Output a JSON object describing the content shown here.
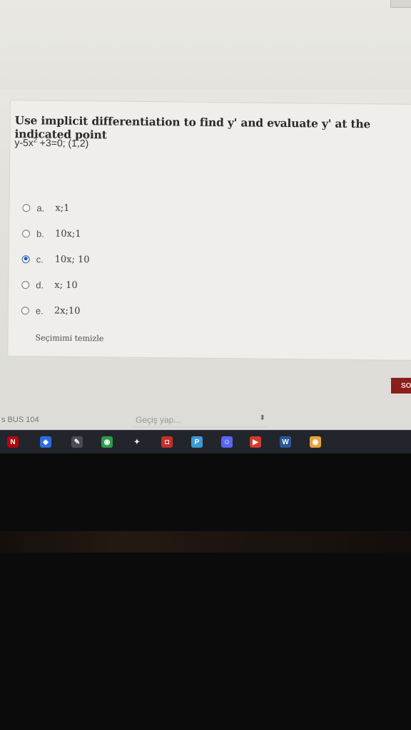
{
  "question": {
    "text": "Use implicit differentiation to find y' and evaluate y' at the indicated point",
    "equation_prefix": "y-5x",
    "equation_exponent": "2",
    "equation_suffix": " +3=0; (1,2)"
  },
  "options": [
    {
      "letter": "a.",
      "value": "x;1",
      "selected": false
    },
    {
      "letter": "b.",
      "value": "10x;1",
      "selected": false
    },
    {
      "letter": "c.",
      "value": "10x; 10",
      "selected": true
    },
    {
      "letter": "d.",
      "value": "x; 10",
      "selected": false
    },
    {
      "letter": "e.",
      "value": "2x;10",
      "selected": false
    }
  ],
  "clear_choice_label": "Seçimimi temizle",
  "next_button_label": "SO",
  "footer": {
    "course_link": "s BUS 104",
    "jump_placeholder": "Geçiş yap...",
    "jump_arrow": "⬍"
  },
  "taskbar": [
    {
      "name": "netflix-icon",
      "glyph": "N",
      "color": "#b1060f"
    },
    {
      "name": "diamond-app-icon",
      "glyph": "◆",
      "color": "#2a6de0"
    },
    {
      "name": "pen-app-icon",
      "glyph": "✎",
      "color": "#4a4d55"
    },
    {
      "name": "chrome-icon",
      "glyph": "◉",
      "color": "#2e9a4b"
    },
    {
      "name": "figma-icon",
      "glyph": "✦",
      "color": "#22252c"
    },
    {
      "name": "camera-app-icon",
      "glyph": "◘",
      "color": "#c4302b"
    },
    {
      "name": "p-app-icon",
      "glyph": "P",
      "color": "#3a9bd8"
    },
    {
      "name": "discord-icon",
      "glyph": "☺",
      "color": "#5865f2"
    },
    {
      "name": "play-app-icon",
      "glyph": "▶",
      "color": "#d33a2c"
    },
    {
      "name": "word-icon",
      "glyph": "W",
      "color": "#2b579a"
    },
    {
      "name": "chrome-profile-icon",
      "glyph": "◉",
      "color": "#e6a23c"
    }
  ],
  "colors": {
    "accent": "#1d5fb8",
    "next_button": "#8a1f1c"
  }
}
